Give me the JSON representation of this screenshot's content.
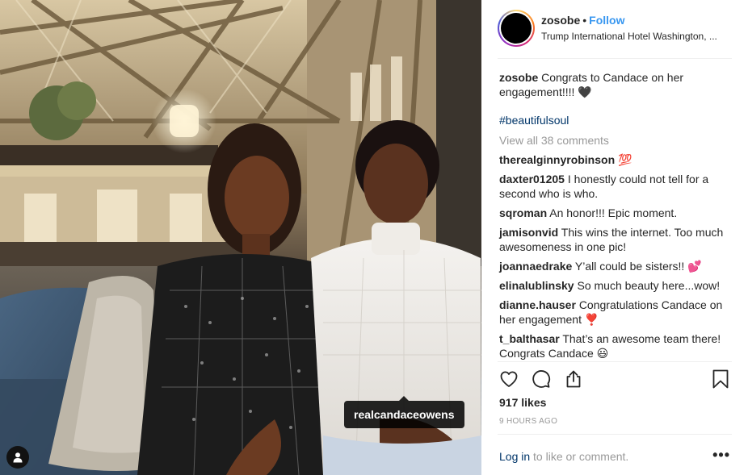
{
  "photo": {
    "tagged_user": "realcandaceowens"
  },
  "post": {
    "username": "zosobe",
    "separator": "•",
    "follow_label": "Follow",
    "location": "Trump International Hotel Washington, ...",
    "caption_user": "zosobe",
    "caption_text": "Congrats to Candace on her engagement!!!! 🖤",
    "hashtag": "#beautifulsoul",
    "view_all": "View all 38 comments",
    "comments": [
      {
        "user": "therealginnyrobinson",
        "text": "💯"
      },
      {
        "user": "daxter01205",
        "text": "I honestly could not tell for a second who is who."
      },
      {
        "user": "sqroman",
        "text": "An honor!!! Epic moment."
      },
      {
        "user": "jamisonvid",
        "text": "This wins the internet. Too much awesomeness in one pic!"
      },
      {
        "user": "joannaedrake",
        "text": "Y’all could be sisters!! 💕"
      },
      {
        "user": "elinalublinsky",
        "text": "So much beauty here...wow!"
      },
      {
        "user": "dianne.hauser",
        "text": "Congratulations Candace on her engagement ❣️"
      },
      {
        "user": "t_balthasar",
        "text": "That’s an awesome team there! Congrats Candace 😃"
      }
    ],
    "likes": "917 likes",
    "time_ago": "9 HOURS AGO",
    "login_link": "Log in",
    "login_suffix": " to like or comment.",
    "more": "•••"
  },
  "icons": {
    "like": "heart-outline-icon",
    "comment": "speech-bubble-icon",
    "share": "share-upload-icon",
    "save": "bookmark-icon",
    "more": "ellipsis-icon",
    "tag": "user-silhouette-icon"
  },
  "colors": {
    "link_blue": "#3897f0",
    "hashtag_blue": "#003569",
    "muted_gray": "#999999",
    "text": "#262626"
  }
}
